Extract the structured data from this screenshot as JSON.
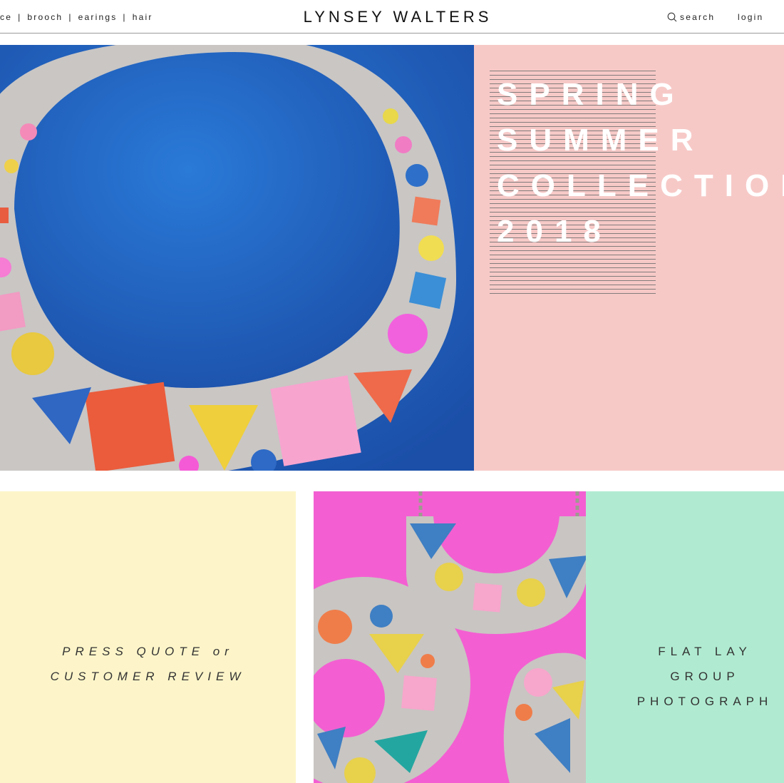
{
  "header": {
    "nav": [
      "ce",
      "brooch",
      "earings",
      "hair"
    ],
    "separator": "|",
    "brand": "LYNSEY WALTERS",
    "search_label": "search",
    "login_label": "login"
  },
  "hero": {
    "title_lines": [
      "SPRING",
      "SUMMER",
      "COLLECTION",
      "2018"
    ],
    "panel_color": "#f6c9c7",
    "image_background": "#1e5bb8"
  },
  "quote": {
    "lines": [
      "PRESS QUOTE or",
      "CUSTOMER REVIEW"
    ],
    "background": "#fdf5c9"
  },
  "pendant": {
    "image_background": "#f35fd2"
  },
  "flatlay": {
    "lines": [
      "FLAT LAY",
      "GROUP",
      "PHOTOGRAPH"
    ],
    "background": "#b0ebd1"
  }
}
